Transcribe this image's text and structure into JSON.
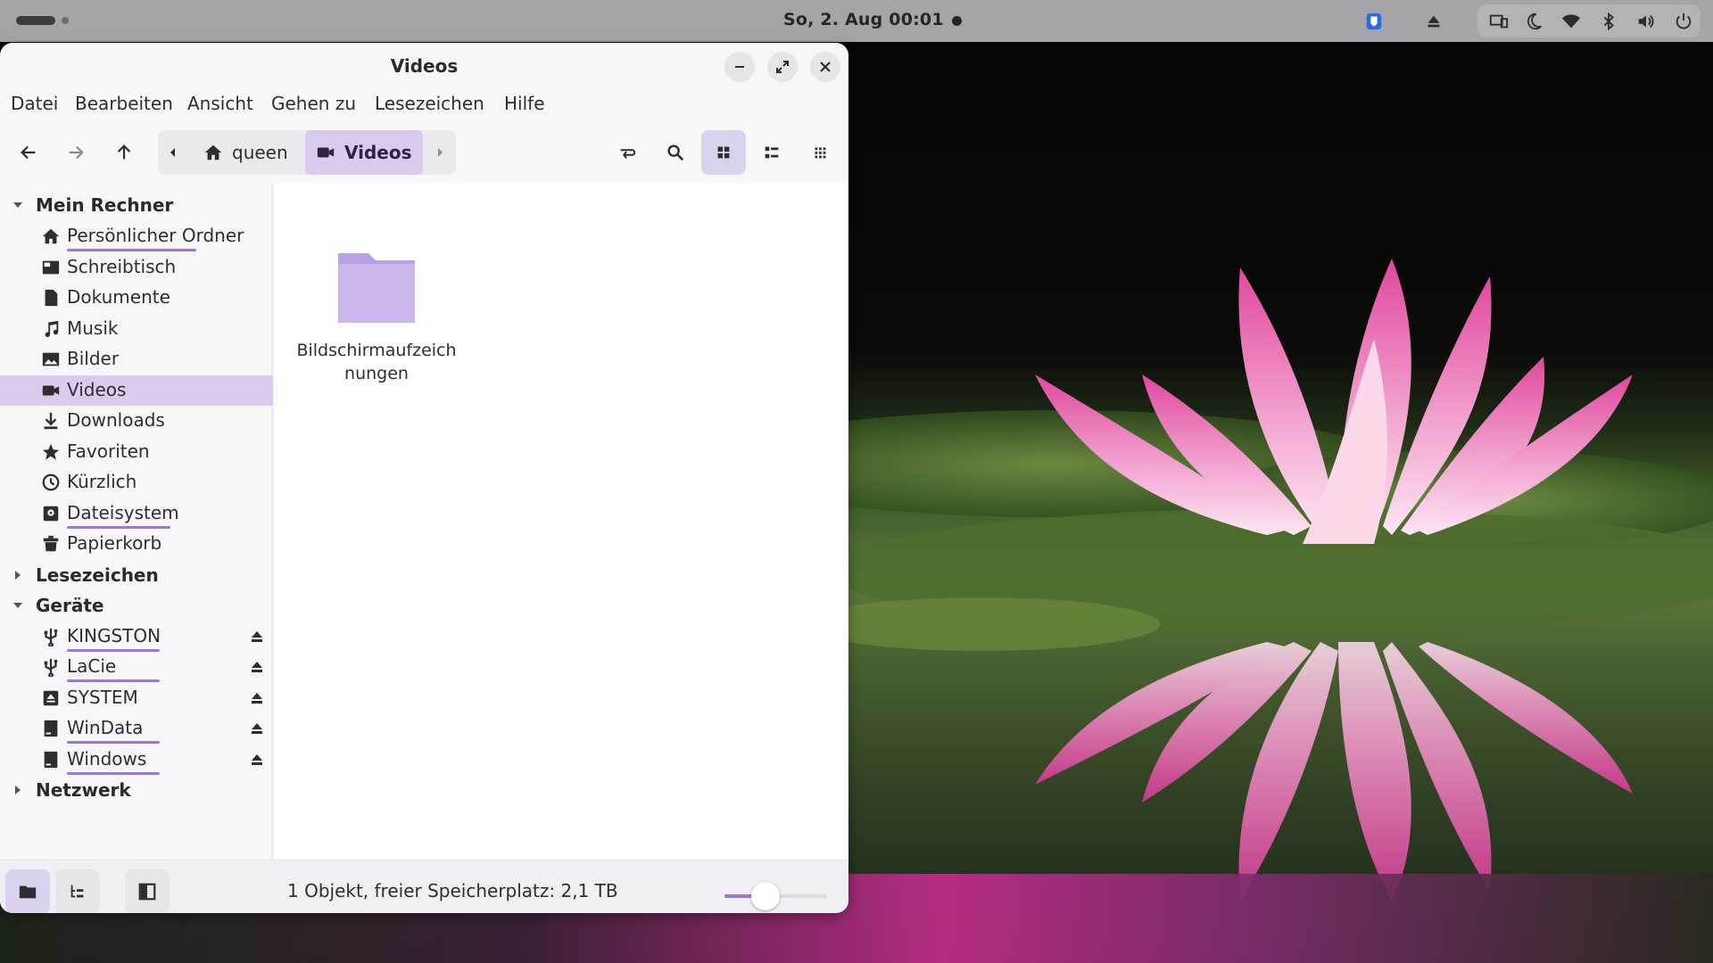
{
  "topbar": {
    "clock": "So, 2. Aug  00:01",
    "tray_icons": [
      "bitwarden-icon",
      "eject-icon",
      "display-icon",
      "night-light-icon",
      "wifi-icon",
      "bluetooth-icon",
      "volume-icon",
      "power-icon"
    ]
  },
  "window": {
    "title": "Videos",
    "menu": [
      "Datei",
      "Bearbeiten",
      "Ansicht",
      "Gehen zu",
      "Lesezeichen",
      "Hilfe"
    ],
    "path": {
      "home": "queen",
      "current": "Videos"
    },
    "view_mode": "icons"
  },
  "sidebar": {
    "sections": [
      {
        "label": "Mein Rechner",
        "expanded": true
      },
      {
        "label": "Lesezeichen",
        "expanded": false
      },
      {
        "label": "Geräte",
        "expanded": true
      },
      {
        "label": "Netzwerk",
        "expanded": false
      }
    ],
    "places": [
      {
        "label": "Persönlicher Ordner",
        "icon": "home-icon",
        "usage": 0.65
      },
      {
        "label": "Schreibtisch",
        "icon": "desktop-icon"
      },
      {
        "label": "Dokumente",
        "icon": "document-icon"
      },
      {
        "label": "Musik",
        "icon": "music-icon"
      },
      {
        "label": "Bilder",
        "icon": "image-icon"
      },
      {
        "label": "Videos",
        "icon": "video-icon",
        "selected": true
      },
      {
        "label": "Downloads",
        "icon": "download-icon"
      },
      {
        "label": "Favoriten",
        "icon": "star-icon"
      },
      {
        "label": "Kürzlich",
        "icon": "clock-icon"
      },
      {
        "label": "Dateisystem",
        "icon": "drive-icon",
        "usage": 0.7
      },
      {
        "label": "Papierkorb",
        "icon": "trash-icon"
      }
    ],
    "devices": [
      {
        "label": "KINGSTON",
        "icon": "usb-icon",
        "usage": 0.55
      },
      {
        "label": "LaCie",
        "icon": "usb-icon",
        "usage": 0.6
      },
      {
        "label": "SYSTEM",
        "icon": "drive-icon"
      },
      {
        "label": "WinData",
        "icon": "disk-icon",
        "usage": 0.55
      },
      {
        "label": "Windows",
        "icon": "disk-icon",
        "usage": 0.62
      }
    ]
  },
  "content": {
    "items": [
      {
        "name": "Bildschirmaufzeichnungen",
        "type": "folder",
        "color": "#c8b3ec"
      }
    ]
  },
  "statusbar": {
    "text": "1 Objekt, freier Speicherplatz: 2,1 TB",
    "zoom": 0.4
  },
  "colors": {
    "accent": "#9b78d8",
    "selection": "#d8cbee",
    "folder": "#c8b3ec"
  }
}
